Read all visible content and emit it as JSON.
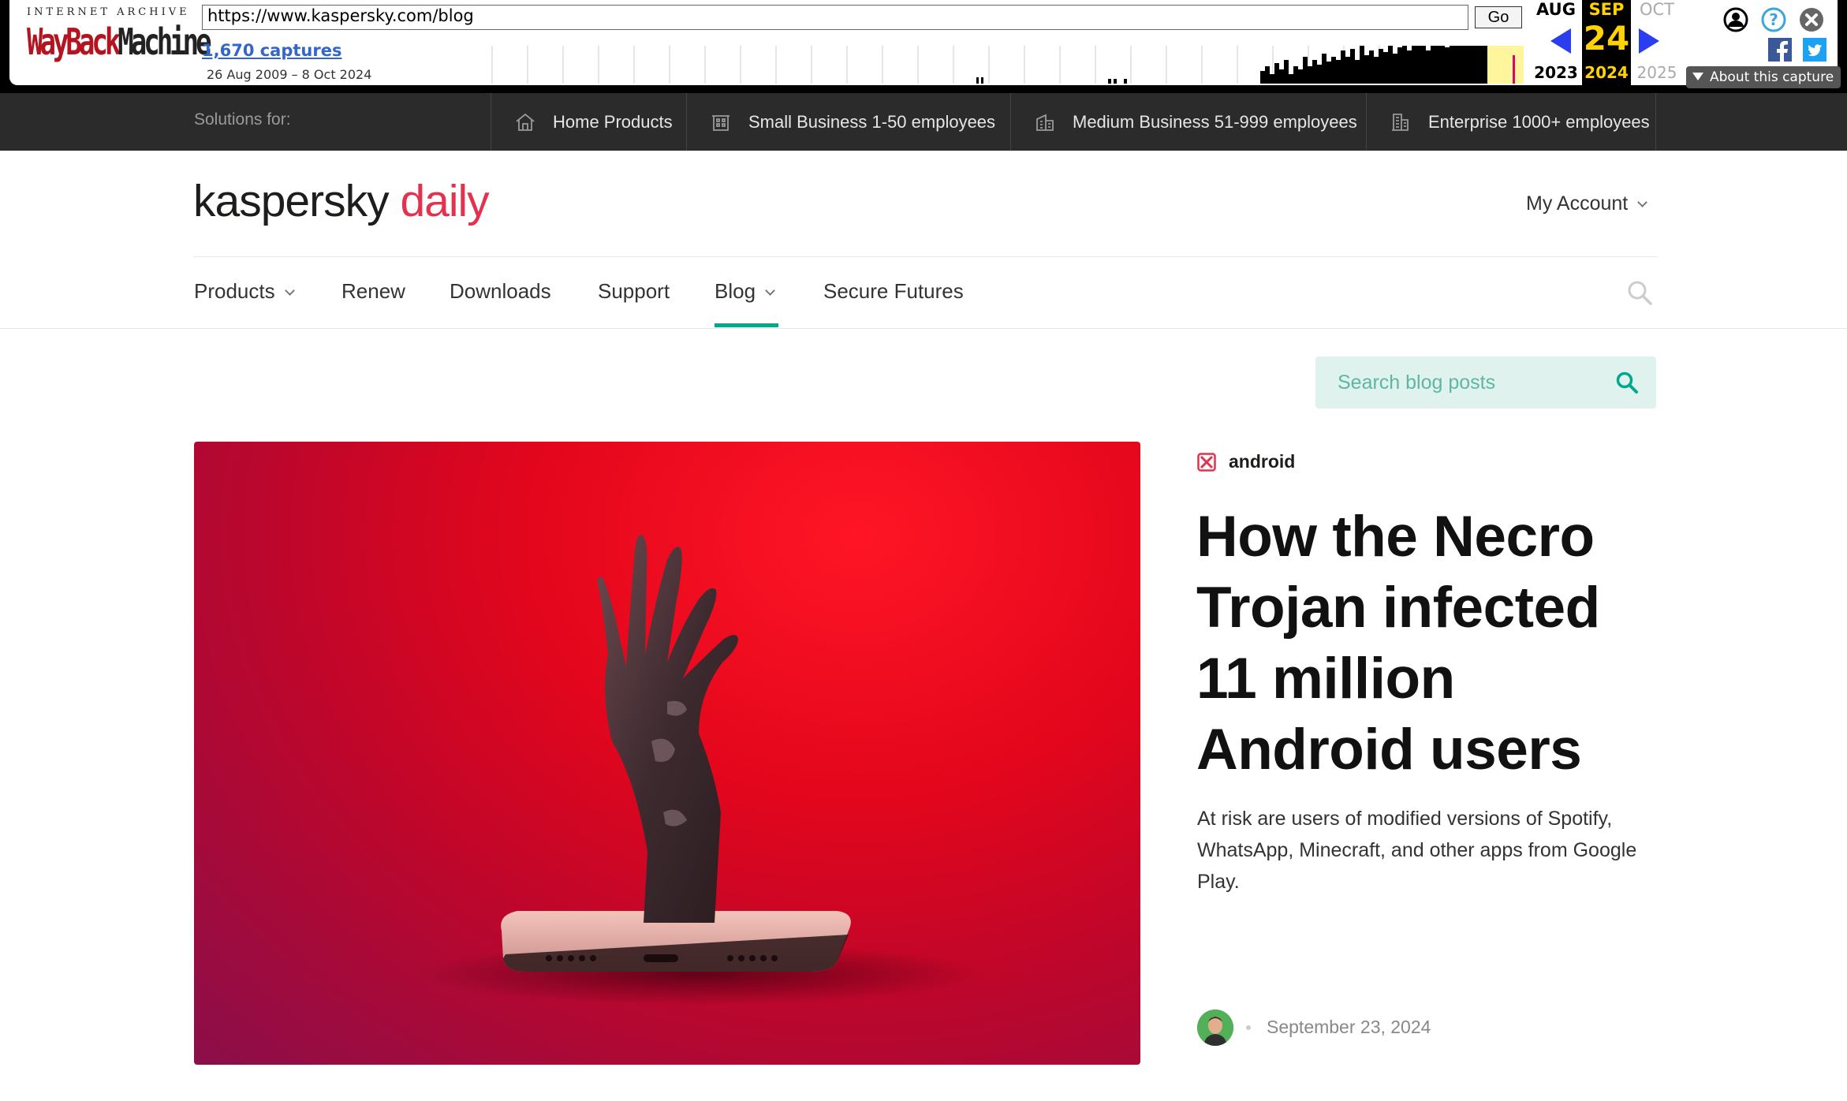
{
  "wayback": {
    "logo_top": "INTERNET ARCHIVE",
    "logo_wayback": "WayBack",
    "logo_machine": "Machine",
    "url": "https://www.kaspersky.com/blog",
    "go": "Go",
    "captures": "1,670 captures",
    "range": "26 Aug 2009 – 8 Oct 2024",
    "months": {
      "prev": "AUG",
      "cur": "SEP",
      "next": "OCT"
    },
    "day": "24",
    "years": {
      "prev": "2023",
      "cur": "2024",
      "next": "2025"
    },
    "about": "About this capture",
    "colors": {
      "arrows": "#2a3ef0",
      "current_month": "#ffd200",
      "highlight": "#fff59d"
    }
  },
  "solutions": {
    "label": "Solutions for:",
    "items": [
      {
        "label": "Home Products",
        "icon": "home-icon"
      },
      {
        "label": "Small Business 1-50 employees",
        "icon": "small-office-icon"
      },
      {
        "label": "Medium Business 51-999 employees",
        "icon": "medium-office-icon"
      },
      {
        "label": "Enterprise 1000+ employees",
        "icon": "enterprise-building-icon"
      }
    ]
  },
  "header": {
    "logo_brand": "kaspersky",
    "logo_section": "daily",
    "account": "My Account"
  },
  "nav": {
    "items": [
      "Products",
      "Renew",
      "Downloads",
      "Support",
      "Blog",
      "Secure Futures"
    ],
    "active": "Blog",
    "accent": "#00a88e"
  },
  "blog_search": {
    "placeholder": "Search blog posts"
  },
  "featured": {
    "tag": "android",
    "title": "How the Necro Trojan infected 11 million Android users",
    "lede": "At risk are users of modified versions of Spotify, WhatsApp, Minecraft, and other apps from Google Play.",
    "date": "September 23, 2024",
    "image": "zombie-hand-from-smartphone"
  }
}
